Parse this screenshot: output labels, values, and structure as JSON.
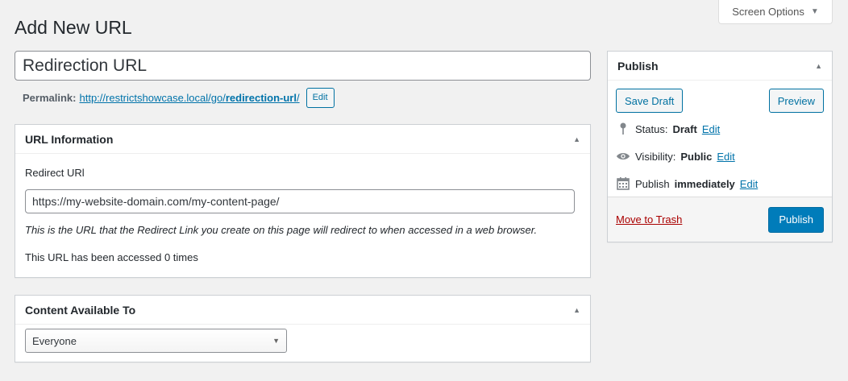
{
  "screen_options": {
    "label": "Screen Options",
    "icon": "triangle-down-icon"
  },
  "page": {
    "title": "Add New URL"
  },
  "title_field": {
    "value": "Redirection URL"
  },
  "permalink": {
    "label": "Permalink:",
    "url_prefix": "http://restrictshowcase.local/go/",
    "slug": "redirection-url",
    "url_suffix": "/",
    "edit_label": "Edit"
  },
  "url_info": {
    "heading": "URL Information",
    "field_label": "Redirect URl",
    "field_value": "https://my-website-domain.com/my-content-page/",
    "description": "This is the URL that the Redirect Link you create on this page will redirect to when accessed in a web browser.",
    "access_count_text": "This URL has been accessed 0 times"
  },
  "content_available": {
    "heading": "Content Available To",
    "selected": "Everyone"
  },
  "publish": {
    "heading": "Publish",
    "save_draft_label": "Save Draft",
    "preview_label": "Preview",
    "status_label": "Status:",
    "status_value": "Draft",
    "visibility_label": "Visibility:",
    "visibility_value": "Public",
    "publish_label": "Publish",
    "publish_value": "immediately",
    "edit_label": "Edit",
    "trash_label": "Move to Trash",
    "publish_button_label": "Publish"
  },
  "colors": {
    "accent": "#0073aa",
    "primary_button": "#007cba",
    "trash": "#a00",
    "background": "#f1f1f1"
  }
}
